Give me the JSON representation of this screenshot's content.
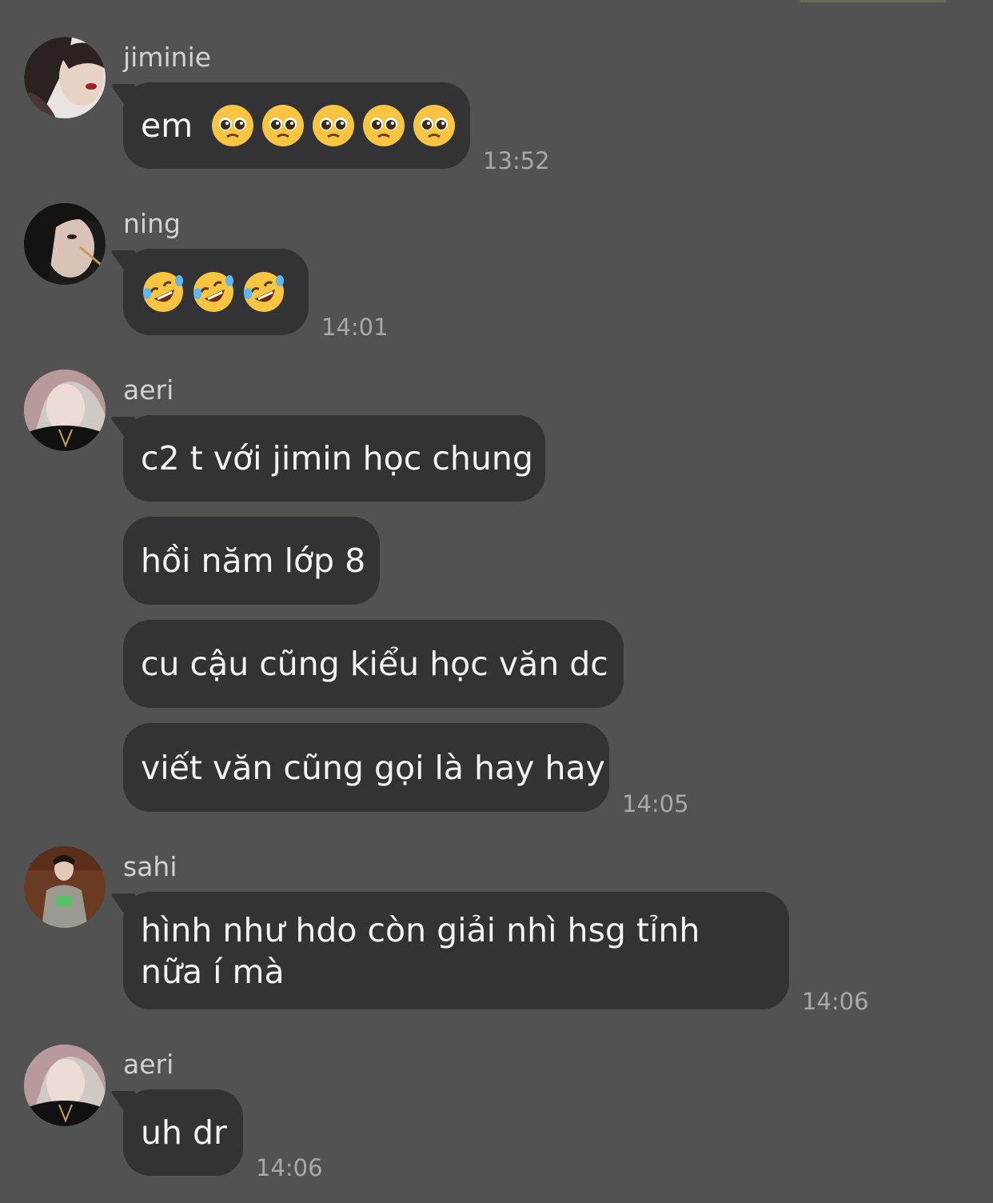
{
  "messages": [
    {
      "sender": "jiminie",
      "text": "em",
      "time": "13:52",
      "avatar_icon": "profile-photo",
      "emoji": "pleading-face-icon",
      "emoji_count": 5
    },
    {
      "sender": "ning",
      "text": "",
      "time": "14:01",
      "avatar_icon": "profile-photo",
      "emoji": "rolling-on-floor-laughing-icon",
      "emoji_count": 3
    },
    {
      "sender": "aeri",
      "lines": [
        "c2 t với jimin học chung",
        "hồi năm lớp 8",
        "cu cậu cũng kiểu học văn dc",
        "viết văn cũng gọi là hay hay"
      ],
      "time": "14:05",
      "avatar_icon": "profile-photo"
    },
    {
      "sender": "sahi",
      "text": "hình như hdo còn giải nhì hsg tỉnh nữa í mà",
      "time": "14:06",
      "avatar_icon": "profile-photo"
    },
    {
      "sender": "aeri",
      "text": "uh dr",
      "time": "14:06",
      "avatar_icon": "profile-photo"
    }
  ],
  "colors": {
    "background": "#535253",
    "bubble": "#333234",
    "text": "#f3f3f3",
    "name": "#d2d2d2",
    "time": "#a9a9a9"
  }
}
